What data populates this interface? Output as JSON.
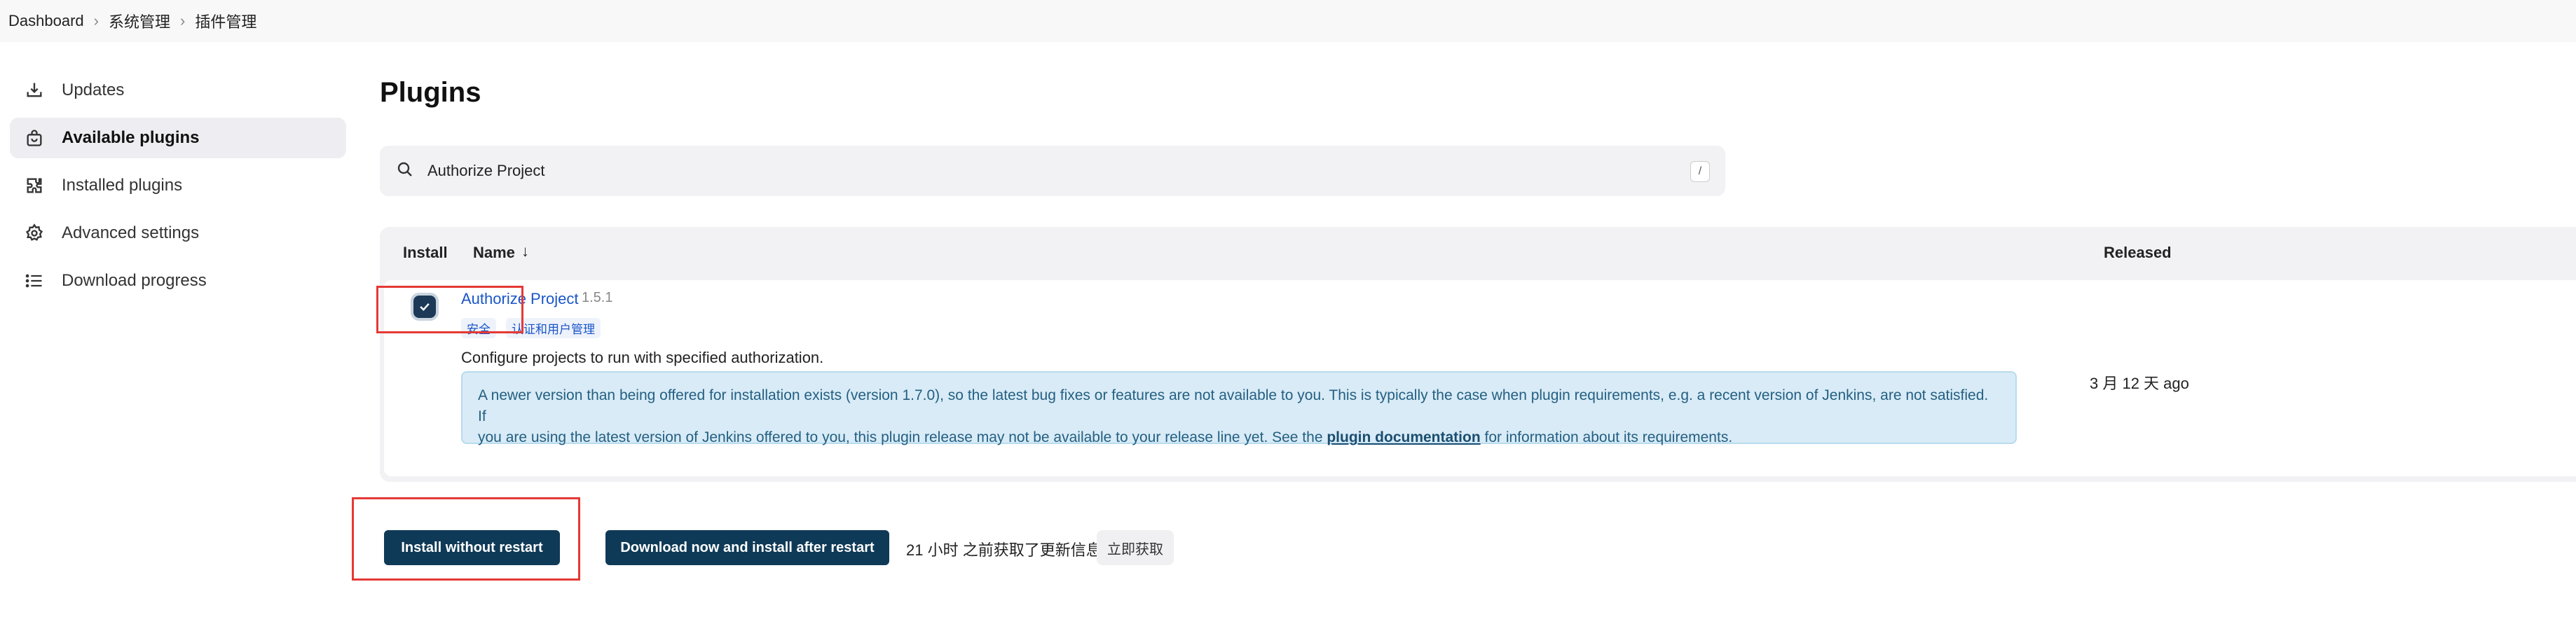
{
  "breadcrumb": {
    "items": [
      "Dashboard",
      "系统管理",
      "插件管理"
    ]
  },
  "sidebar": {
    "items": [
      {
        "label": "Updates",
        "icon": "download-icon"
      },
      {
        "label": "Available plugins",
        "icon": "shopping-bag-icon",
        "active": true
      },
      {
        "label": "Installed plugins",
        "icon": "puzzle-icon"
      },
      {
        "label": "Advanced settings",
        "icon": "gear-icon"
      },
      {
        "label": "Download progress",
        "icon": "list-icon"
      }
    ]
  },
  "main": {
    "title": "Plugins",
    "search": {
      "value": "Authorize Project",
      "shortcut": "/"
    },
    "table": {
      "headers": {
        "install": "Install",
        "name": "Name",
        "sort_indicator": "↓",
        "released": "Released"
      },
      "rows": [
        {
          "checked": true,
          "name": "Authorize Project",
          "version": "1.5.1",
          "tags": [
            "安全",
            "认证和用户管理"
          ],
          "description": "Configure projects to run with specified authorization.",
          "alert_line1": "A newer version than being offered for installation exists (version 1.7.0), so the latest bug fixes or features are not available to you. This is typically the case when plugin requirements, e.g. a recent version of Jenkins, are not satisfied. If",
          "alert_line2_before": "you are using the latest version of Jenkins offered to you, this plugin release may not be available to your release line yet. See the ",
          "alert_link": "plugin documentation",
          "alert_line2_after": " for information about its requirements.",
          "released": "3 月 12 天 ago"
        }
      ]
    },
    "actions": {
      "install_without_restart": "Install without restart",
      "download_and_install_after_restart": "Download now and install after restart",
      "update_info": "21 小时 之前获取了更新信息",
      "refresh": "立即获取"
    }
  },
  "colors": {
    "primary_button": "#0f3a57",
    "link": "#1a56c9",
    "alert_bg": "#d8ebf6",
    "highlight": "#e53935"
  }
}
